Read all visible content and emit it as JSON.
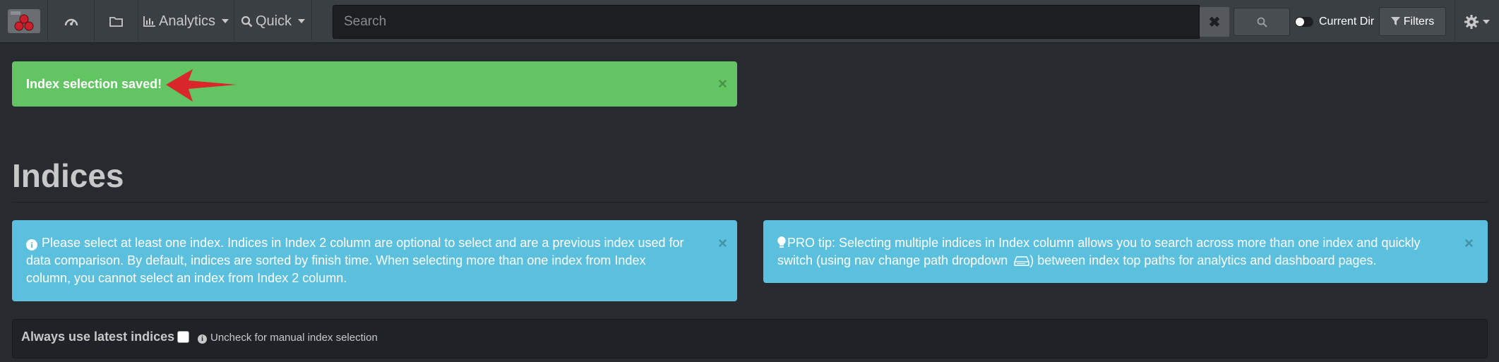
{
  "navbar": {
    "analytics_label": "Analytics",
    "quick_label": "Quick",
    "search_placeholder": "Search",
    "clear_label": "✖",
    "current_dir_label": "Current Dir",
    "filters_label": "Filters"
  },
  "alerts": {
    "success_message": "Index selection saved!",
    "close_glyph": "×",
    "info_left_lines": [
      "Please select at least one index. Indices in Index 2 column are optional to select and are a previous index used for",
      "data comparison. By default, indices are sorted by finish time. When selecting more than one index from Index",
      "column, you cannot select an index from Index 2 column."
    ],
    "info_right_line1": "PRO tip: Selecting multiple indices in Index column allows you to search across more than one index and quickly",
    "info_right_line2_a": "switch (using nav change path dropdown",
    "info_right_line2_b": ") between index top paths for analytics and dashboard pages."
  },
  "page": {
    "title": "Indices",
    "always_latest_label": "Always use latest indices",
    "always_latest_hint": "Uncheck for manual index selection"
  },
  "colors": {
    "background": "#272b30",
    "navbar": "#3a3f44",
    "success": "#62c462",
    "info": "#5bc0de",
    "arrow": "#d9262a"
  },
  "icons": {
    "logo": "app-logo",
    "dashboard": "dashboard-icon",
    "folder": "folder-icon",
    "analytics": "bar-chart-icon",
    "quick": "search-icon",
    "settings": "gear-icon",
    "filters": "filter-icon",
    "tip": "lightbulb-icon",
    "info": "info-circle-icon",
    "drive": "hard-drive-icon"
  }
}
